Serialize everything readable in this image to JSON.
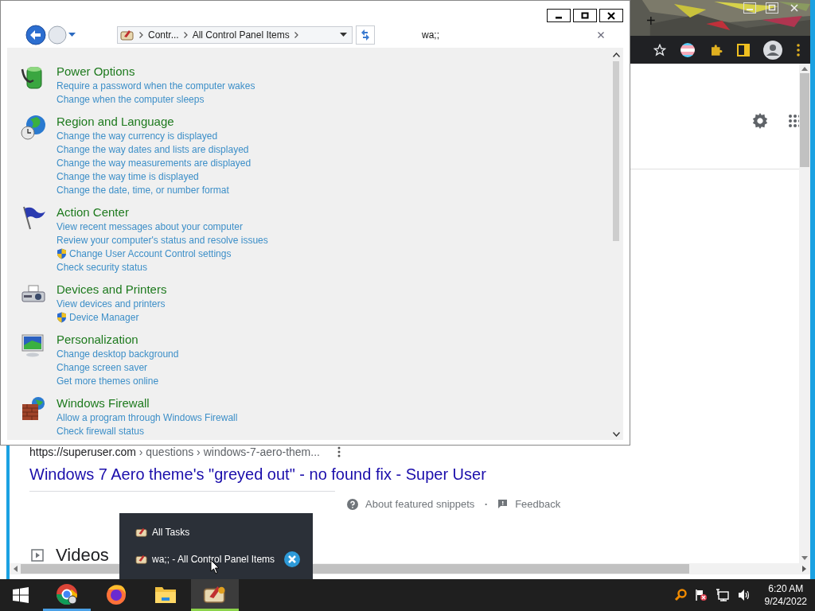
{
  "control_panel": {
    "breadcrumb": [
      "Contr...",
      "All Control Panel Items"
    ],
    "search": {
      "value": "wa;;"
    },
    "items": [
      {
        "kind": "power",
        "title": "Power Options",
        "links": [
          {
            "text": "Require a password when the computer wakes",
            "shield": false
          },
          {
            "text": "Change when the computer sleeps",
            "shield": false
          }
        ]
      },
      {
        "kind": "region",
        "title": "Region and Language",
        "links": [
          {
            "text": "Change the way currency is displayed",
            "shield": false
          },
          {
            "text": "Change the way dates and lists are displayed",
            "shield": false
          },
          {
            "text": "Change the way measurements are displayed",
            "shield": false
          },
          {
            "text": "Change the way time is displayed",
            "shield": false
          },
          {
            "text": "Change the date, time, or number format",
            "shield": false
          }
        ]
      },
      {
        "kind": "action",
        "title": "Action Center",
        "links": [
          {
            "text": "View recent messages about your computer",
            "shield": false
          },
          {
            "text": "Review your computer's status and resolve issues",
            "shield": false
          },
          {
            "text": "Change User Account Control settings",
            "shield": true
          },
          {
            "text": "Check security status",
            "shield": false
          }
        ]
      },
      {
        "kind": "devices",
        "title": "Devices and Printers",
        "links": [
          {
            "text": "View devices and printers",
            "shield": false
          },
          {
            "text": "Device Manager",
            "shield": true
          }
        ]
      },
      {
        "kind": "personalization",
        "title": "Personalization",
        "links": [
          {
            "text": "Change desktop background",
            "shield": false
          },
          {
            "text": "Change screen saver",
            "shield": false
          },
          {
            "text": "Get more themes online",
            "shield": false
          }
        ]
      },
      {
        "kind": "firewall",
        "title": "Windows Firewall",
        "links": [
          {
            "text": "Allow a program through Windows Firewall",
            "shield": false
          },
          {
            "text": "Check firewall status",
            "shield": false
          }
        ]
      }
    ]
  },
  "browser": {
    "tab_strip": {
      "new_tab": "+"
    },
    "result": {
      "url_host": "https://superuser.com",
      "url_path": "› questions › windows-7-aero-them...",
      "title": "Windows 7 Aero theme's \"greyed out\" - no found fix - Super User",
      "about": "About featured snippets",
      "separator": "•",
      "feedback": "Feedback"
    },
    "section": "Videos"
  },
  "jump_list": {
    "header": "All Tasks",
    "window": "wa;; - All Control Panel Items"
  },
  "taskbar": {
    "apps": [
      {
        "kind": "chrome",
        "running": true,
        "selected": false
      },
      {
        "kind": "firefox",
        "running": false,
        "selected": false
      },
      {
        "kind": "explorer",
        "running": false,
        "selected": false
      },
      {
        "kind": "control_panel",
        "running": true,
        "selected": true
      }
    ],
    "time": "6:20 AM",
    "date": "9/24/2022"
  }
}
